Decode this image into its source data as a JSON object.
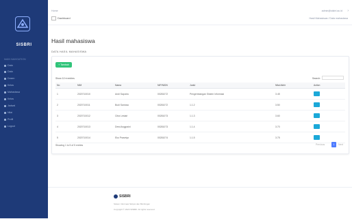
{
  "sidebar": {
    "brand": "SISBRI",
    "heading": "MAIN NAVIGATION",
    "items": [
      "Data",
      "Data",
      "Dosen",
      "Kelas",
      "Mahasiswa",
      "Kelas",
      "Jadwal",
      "Nilai",
      "Profil",
      "Logout"
    ]
  },
  "topbar": {
    "left_text": "Home",
    "user": "admin@sisbri.ac.id",
    "breadcrumb": "Dashboard",
    "right_text": "Hasil Mahasiswa / Data mahasiswa"
  },
  "page": {
    "title": "Hasil mahasiswa",
    "section": "DATA HASIL MAHASISWA"
  },
  "card": {
    "add_button": "+ Tambah",
    "show_entries": "Show 10 ▾ entries",
    "search_label": "Search:",
    "columns": [
      "No",
      "NIM",
      "Nama",
      "NIP/NIDN",
      "Judul",
      "Nilai Akhir",
      "Action"
    ],
    "rows": [
      [
        "1",
        "2020710010",
        "Andi Saputra",
        "00281072",
        "Pengembangan Sistem Informasi",
        "3.45",
        ""
      ],
      [
        "2",
        "2020710011",
        "Budi Santoso",
        "00281072",
        "1.1.2",
        "3.50",
        ""
      ],
      [
        "3",
        "2020710012",
        "Citra Lestari",
        "00281073",
        "1.1.3",
        "3.60",
        ""
      ],
      [
        "4",
        "2020710013",
        "Dewi Anggraini",
        "00281073",
        "1.1.4",
        "3.70",
        ""
      ],
      [
        "5",
        "2020710014",
        "Eko Prasetyo",
        "00281074",
        "1.1.5",
        "3.75",
        ""
      ]
    ],
    "showing": "Showing 1 to 5 of 5 entries",
    "prev": "Previous",
    "current_page": "1",
    "next": "Next"
  },
  "footer": {
    "name": "SISBRI",
    "line1": "Sistem Informasi Skripsi dan Bimbingan",
    "line2": "Copyright © 2023 SISBRI. All rights reserved."
  },
  "colors": {
    "sidebar": "#1e3a78",
    "accent_green": "#31c47a",
    "accent_blue": "#1ba8d8",
    "pagination": "#4f7cff"
  }
}
